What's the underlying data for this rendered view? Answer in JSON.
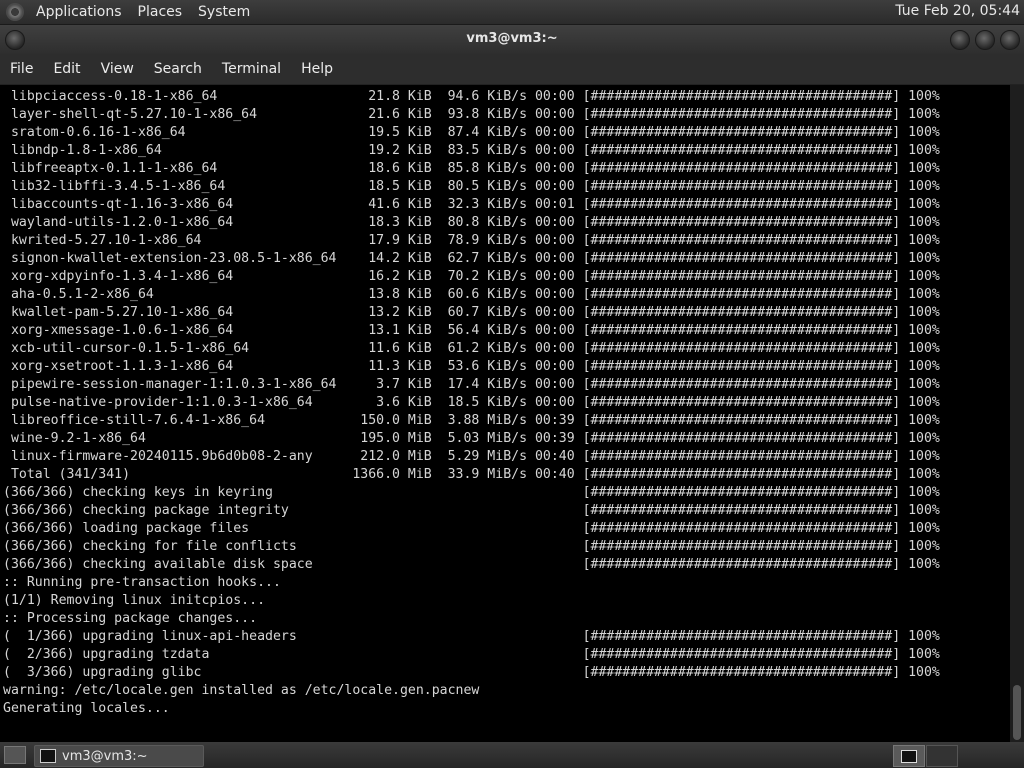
{
  "top_panel": {
    "menus": [
      "Applications",
      "Places",
      "System"
    ],
    "clock": "Tue Feb 20, 05:44"
  },
  "window": {
    "title": "vm3@vm3:~",
    "menubar": [
      "File",
      "Edit",
      "View",
      "Search",
      "Terminal",
      "Help"
    ]
  },
  "terminal": {
    "lines": [
      " libpciaccess-0.18-1-x86_64                   21.8 KiB  94.6 KiB/s 00:00 [######################################] 100%",
      " layer-shell-qt-5.27.10-1-x86_64              21.6 KiB  93.8 KiB/s 00:00 [######################################] 100%",
      " sratom-0.6.16-1-x86_64                       19.5 KiB  87.4 KiB/s 00:00 [######################################] 100%",
      " libndp-1.8-1-x86_64                          19.2 KiB  83.5 KiB/s 00:00 [######################################] 100%",
      " libfreeaptx-0.1.1-1-x86_64                   18.6 KiB  85.8 KiB/s 00:00 [######################################] 100%",
      " lib32-libffi-3.4.5-1-x86_64                  18.5 KiB  80.5 KiB/s 00:00 [######################################] 100%",
      " libaccounts-qt-1.16-3-x86_64                 41.6 KiB  32.3 KiB/s 00:01 [######################################] 100%",
      " wayland-utils-1.2.0-1-x86_64                 18.3 KiB  80.8 KiB/s 00:00 [######################################] 100%",
      " kwrited-5.27.10-1-x86_64                     17.9 KiB  78.9 KiB/s 00:00 [######################################] 100%",
      " signon-kwallet-extension-23.08.5-1-x86_64    14.2 KiB  62.7 KiB/s 00:00 [######################################] 100%",
      " xorg-xdpyinfo-1.3.4-1-x86_64                 16.2 KiB  70.2 KiB/s 00:00 [######################################] 100%",
      " aha-0.5.1-2-x86_64                           13.8 KiB  60.6 KiB/s 00:00 [######################################] 100%",
      " kwallet-pam-5.27.10-1-x86_64                 13.2 KiB  60.7 KiB/s 00:00 [######################################] 100%",
      " xorg-xmessage-1.0.6-1-x86_64                 13.1 KiB  56.4 KiB/s 00:00 [######################################] 100%",
      " xcb-util-cursor-0.1.5-1-x86_64               11.6 KiB  61.2 KiB/s 00:00 [######################################] 100%",
      " xorg-xsetroot-1.1.3-1-x86_64                 11.3 KiB  53.6 KiB/s 00:00 [######################################] 100%",
      " pipewire-session-manager-1:1.0.3-1-x86_64     3.7 KiB  17.4 KiB/s 00:00 [######################################] 100%",
      " pulse-native-provider-1:1.0.3-1-x86_64        3.6 KiB  18.5 KiB/s 00:00 [######################################] 100%",
      " libreoffice-still-7.6.4-1-x86_64            150.0 MiB  3.88 MiB/s 00:39 [######################################] 100%",
      " wine-9.2-1-x86_64                           195.0 MiB  5.03 MiB/s 00:39 [######################################] 100%",
      " linux-firmware-20240115.9b6d0b08-2-any      212.0 MiB  5.29 MiB/s 00:40 [######################################] 100%",
      " Total (341/341)                            1366.0 MiB  33.9 MiB/s 00:40 [######################################] 100%",
      "(366/366) checking keys in keyring                                       [######################################] 100%",
      "(366/366) checking package integrity                                     [######################################] 100%",
      "(366/366) loading package files                                          [######################################] 100%",
      "(366/366) checking for file conflicts                                    [######################################] 100%",
      "(366/366) checking available disk space                                  [######################################] 100%",
      ":: Running pre-transaction hooks...",
      "(1/1) Removing linux initcpios...",
      ":: Processing package changes...",
      "(  1/366) upgrading linux-api-headers                                    [######################################] 100%",
      "(  2/366) upgrading tzdata                                               [######################################] 100%",
      "(  3/366) upgrading glibc                                                [######################################] 100%",
      "warning: /etc/locale.gen installed as /etc/locale.gen.pacnew",
      "Generating locales..."
    ]
  },
  "taskbar": {
    "task_label": "vm3@vm3:~"
  }
}
